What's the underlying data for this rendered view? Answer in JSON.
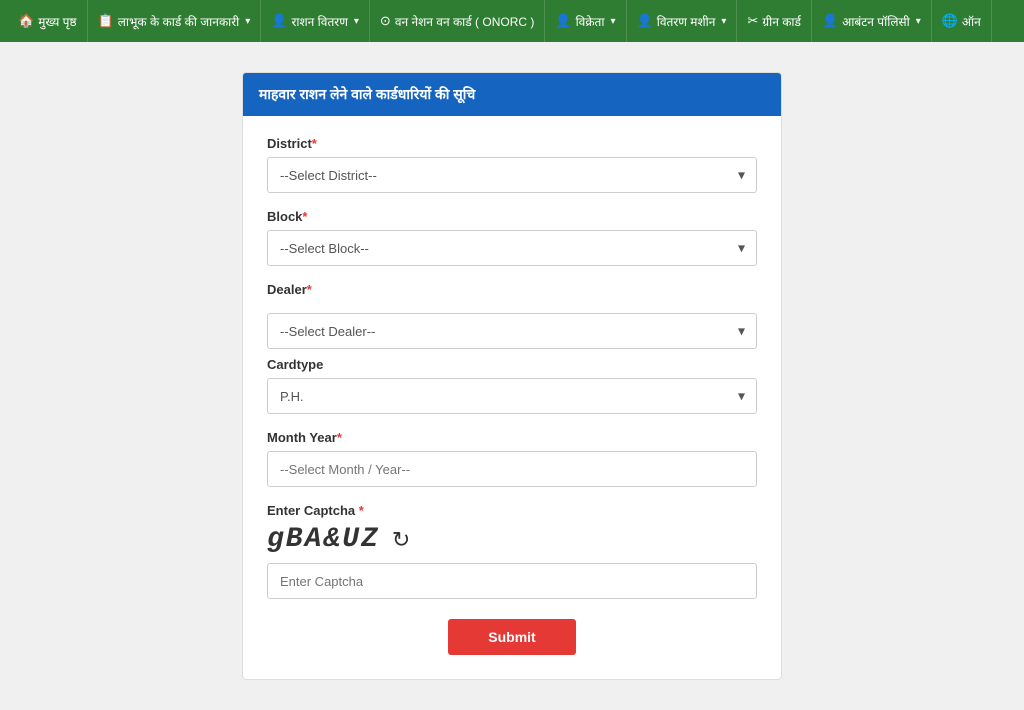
{
  "navbar": {
    "items": [
      {
        "label": "मुख्य पृष्ठ",
        "icon": "🏠",
        "hasDropdown": false
      },
      {
        "label": "लाभूक के कार्ड की जानकारी",
        "icon": "📋",
        "hasDropdown": true
      },
      {
        "label": "राशन वितरण",
        "icon": "👤",
        "hasDropdown": true
      },
      {
        "label": "वन नेशन वन कार्ड ( ONORC )",
        "icon": "⊙",
        "hasDropdown": false
      },
      {
        "label": "विक्रेता",
        "icon": "👤",
        "hasDropdown": true
      },
      {
        "label": "वितरण मशीन",
        "icon": "👤",
        "hasDropdown": true
      },
      {
        "label": "ग्रीन कार्ड",
        "icon": "✂",
        "hasDropdown": false
      },
      {
        "label": "आबंटन पॉलिसी",
        "icon": "👤",
        "hasDropdown": true
      },
      {
        "label": "ऑन",
        "icon": "🌐",
        "hasDropdown": false
      }
    ]
  },
  "form": {
    "title": "माहवार राशन लेने वाले कार्डधारियों की सूचि",
    "fields": {
      "district": {
        "label": "District",
        "required": true,
        "placeholder": "--Select District--",
        "options": [
          "--Select District--"
        ]
      },
      "block": {
        "label": "Block",
        "required": true,
        "placeholder": "--Select Block--",
        "options": [
          "--Select Block--"
        ]
      },
      "dealer": {
        "label": "Dealer",
        "required": true,
        "placeholder": "--Select Dealer--",
        "options": [
          "--Select Dealer--"
        ]
      },
      "cardtype": {
        "label": "Cardtype",
        "required": false,
        "value": "P.H.",
        "options": [
          "P.H."
        ]
      },
      "monthyear": {
        "label": "Month Year",
        "required": true,
        "placeholder": "--Select Month / Year--"
      },
      "captcha": {
        "label": "Enter Captcha",
        "required": true,
        "captcha_value": "gBA&UZ",
        "placeholder": "Enter Captcha"
      }
    },
    "submit_label": "Submit"
  }
}
